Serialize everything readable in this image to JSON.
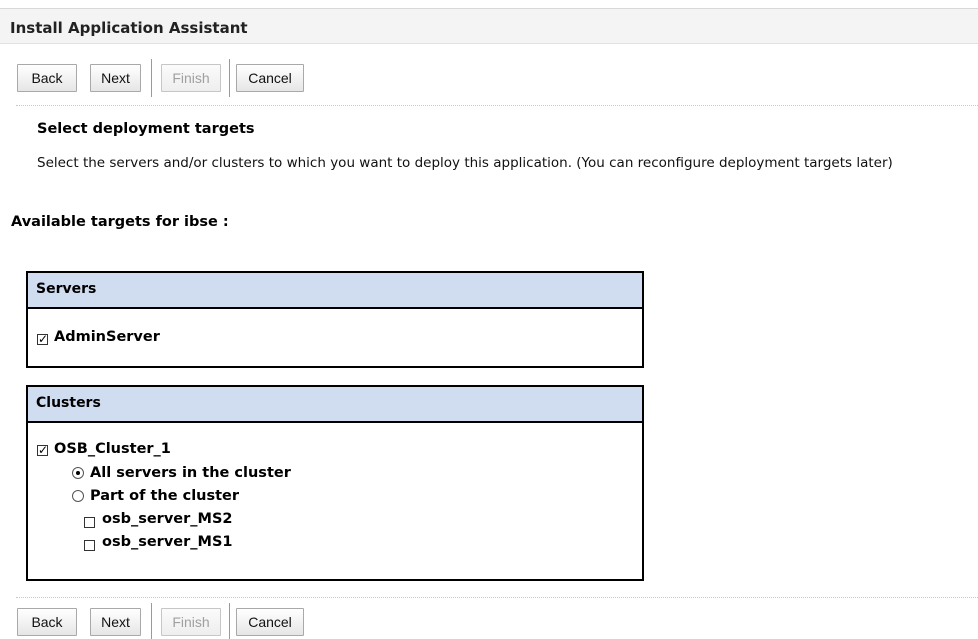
{
  "window": {
    "title": "Install Application Assistant"
  },
  "buttons": {
    "back": "Back",
    "next": "Next",
    "finish": "Finish",
    "cancel": "Cancel"
  },
  "content": {
    "heading": "Select deployment targets",
    "instruction": "Select the servers and/or clusters to which you want to deploy this application. (You can reconfigure deployment targets later)",
    "available_label": "Available targets for ibse :"
  },
  "servers": {
    "header": "Servers",
    "items": [
      {
        "label": "AdminServer",
        "checked": true
      }
    ]
  },
  "clusters": {
    "header": "Clusters",
    "cluster": {
      "label": "OSB_Cluster_1",
      "checked": true
    },
    "options": [
      {
        "label": "All servers in the cluster",
        "selected": true
      },
      {
        "label": "Part of the cluster",
        "selected": false
      }
    ],
    "members": [
      {
        "label": "osb_server_MS2",
        "checked": false
      },
      {
        "label": "osb_server_MS1",
        "checked": false
      }
    ]
  }
}
